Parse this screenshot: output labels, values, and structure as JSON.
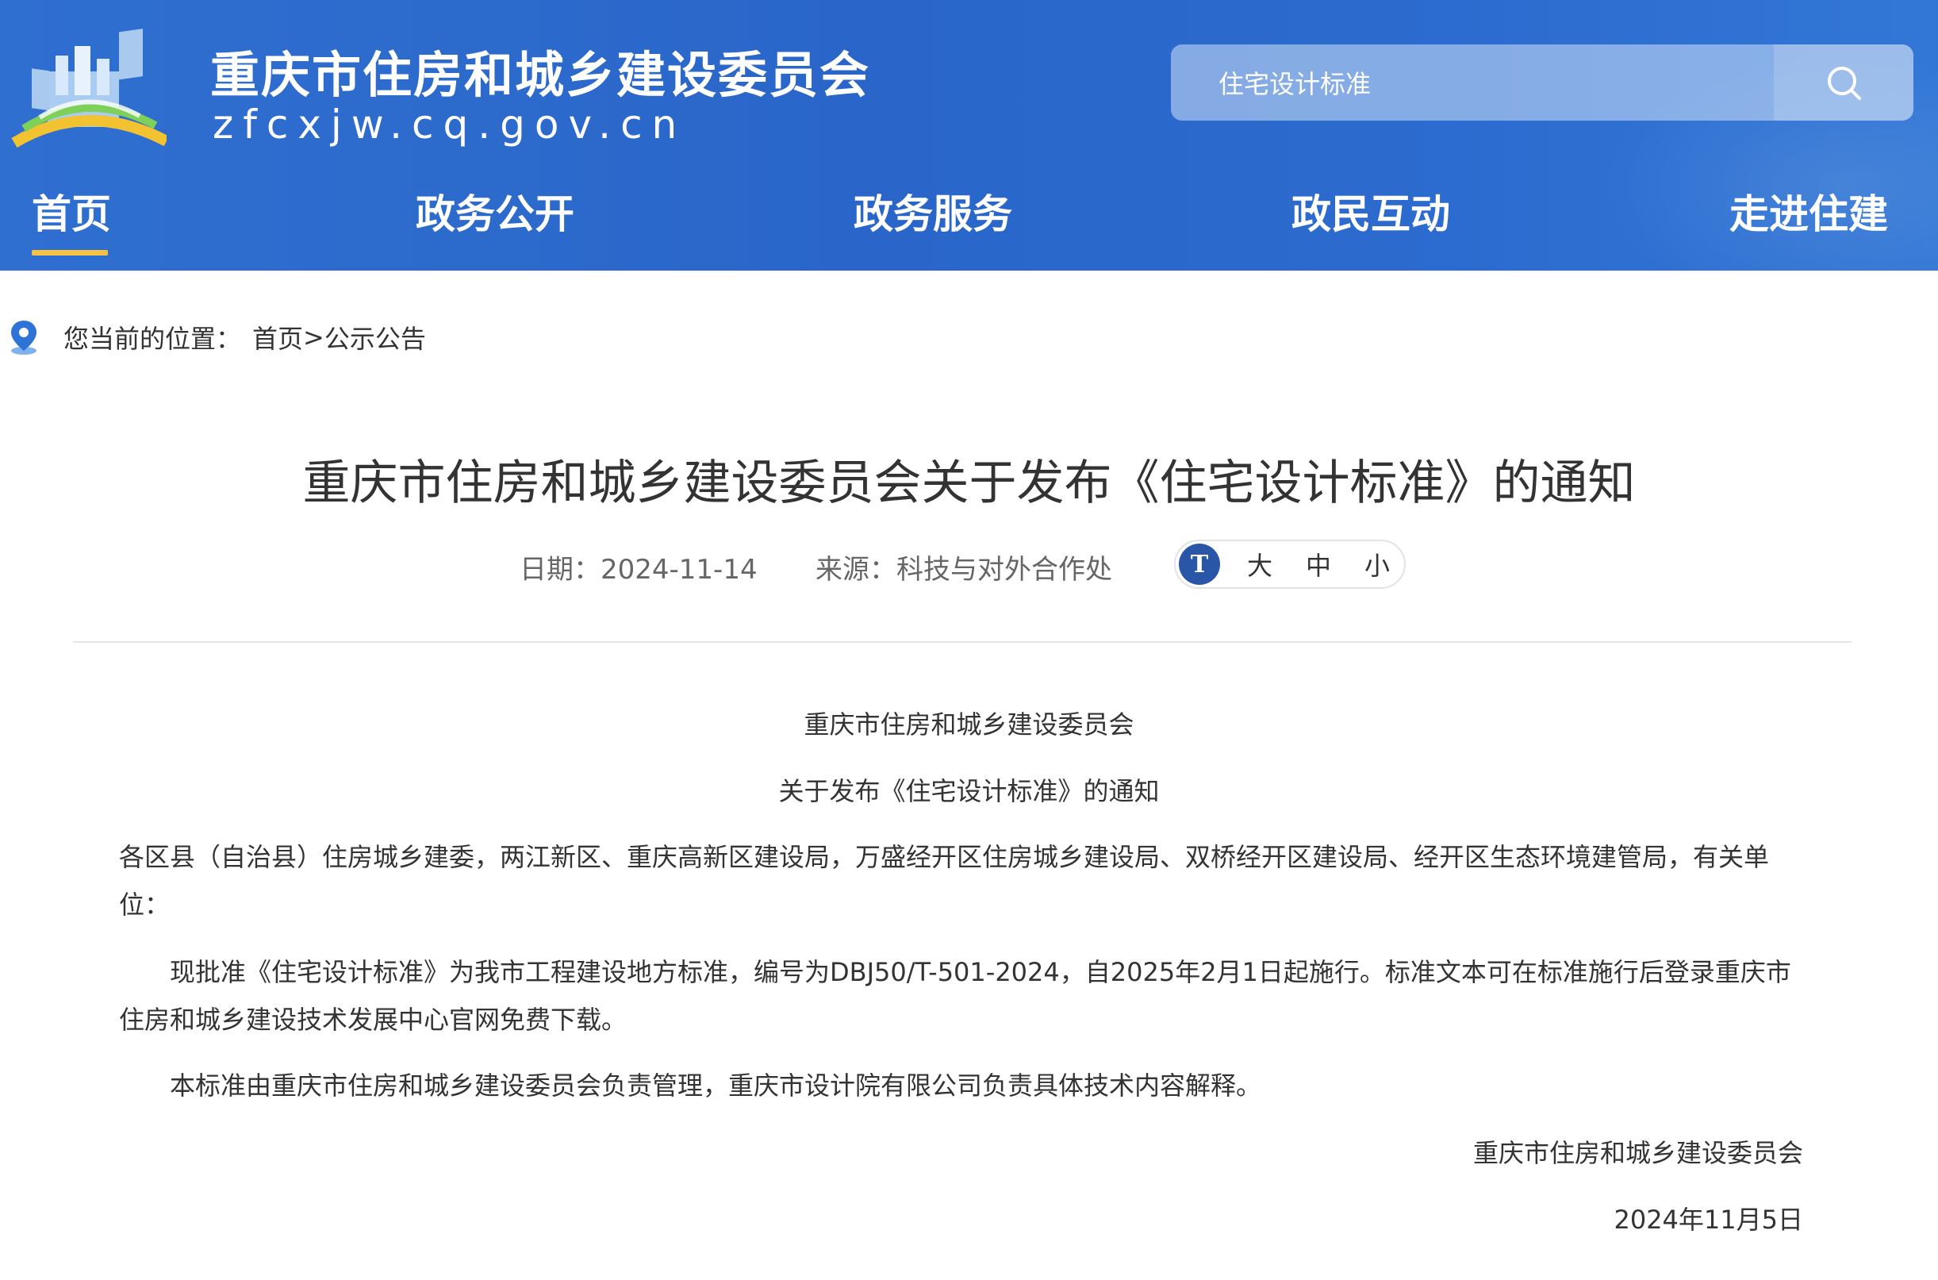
{
  "header": {
    "site_title": "重庆市住房和城乡建设委员会",
    "site_url": "zfcxjw.cq.gov.cn",
    "search": {
      "value": "住宅设计标准"
    },
    "nav": [
      {
        "label": "首页"
      },
      {
        "label": "政务公开"
      },
      {
        "label": "政务服务"
      },
      {
        "label": "政民互动"
      },
      {
        "label": "走进住建"
      }
    ],
    "colors": {
      "header_bg": "#2c6bcf",
      "nav_active_underline": "#f5c243"
    }
  },
  "breadcrumb": {
    "prefix": "您当前的位置：",
    "home": "首页",
    "separator": ">",
    "current": "公示公告"
  },
  "article": {
    "title": "重庆市住房和城乡建设委员会关于发布《住宅设计标准》的通知",
    "date": "日期：2024-11-14",
    "source": "来源：科技与对外合作处",
    "font_sizes": {
      "large": "大",
      "medium": "中",
      "small": "小"
    },
    "issuer_line": "重庆市住房和城乡建设委员会",
    "subject_line": "关于发布《住宅设计标准》的通知",
    "recipients": "各区县（自治县）住房城乡建委，两江新区、重庆高新区建设局，万盛经开区住房城乡建设局、双桥经开区建设局、经开区生态环境建管局，有关单位：",
    "paragraph1": "现批准《住宅设计标准》为我市工程建设地方标准，编号为DBJ50/T-501-2024，自2025年2月1日起施行。标准文本可在标准施行后登录重庆市住房和城乡建设技术发展中心官网免费下载。",
    "paragraph2": "本标准由重庆市住房和城乡建设委员会负责管理，重庆市设计院有限公司负责具体技术内容解释。",
    "signature": "重庆市住房和城乡建设委员会",
    "sign_date": "2024年11月5日"
  }
}
